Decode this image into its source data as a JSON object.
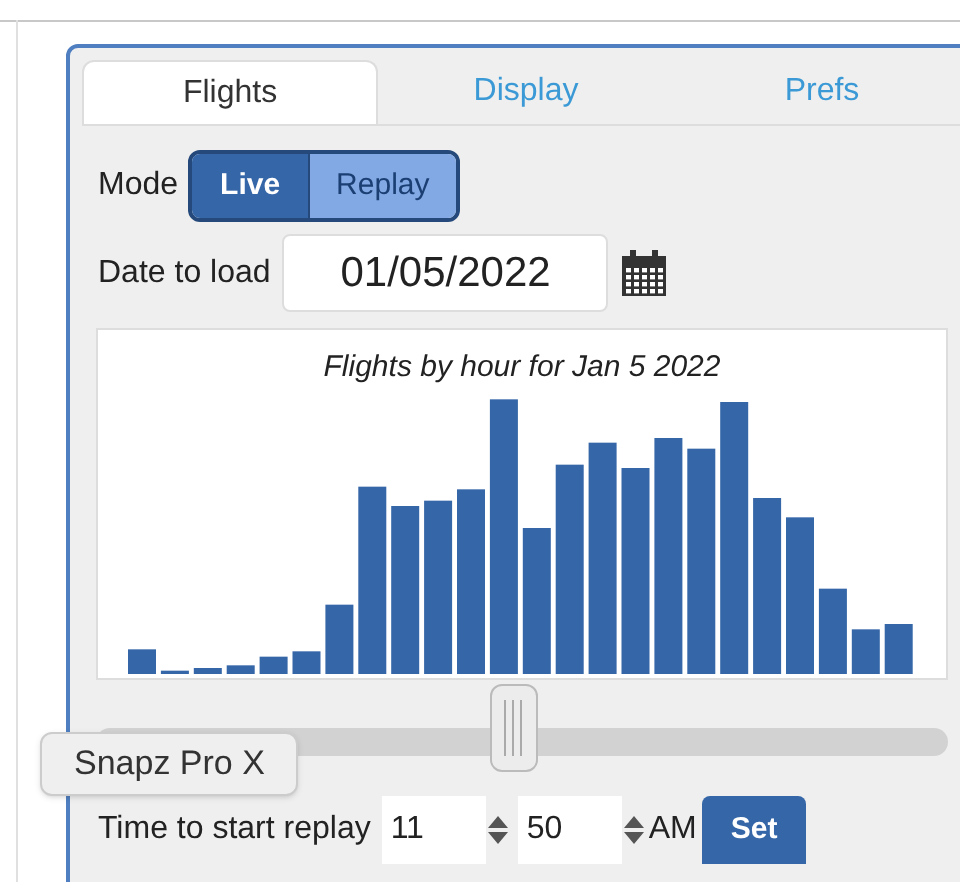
{
  "tabs": [
    {
      "label": "Flights",
      "selected": true
    },
    {
      "label": "Display",
      "selected": false
    },
    {
      "label": "Prefs",
      "selected": false
    }
  ],
  "mode": {
    "label": "Mode",
    "options": [
      {
        "label": "Live",
        "selected": true
      },
      {
        "label": "Replay",
        "selected": false
      }
    ]
  },
  "date": {
    "label": "Date to load",
    "value": "01/05/2022"
  },
  "chart": {
    "title": "Flights by hour for Jan 5 2022"
  },
  "slider": {
    "level": 0.49
  },
  "replay_time": {
    "label": "Time to start replay",
    "hour": "11",
    "minute": "50",
    "period": "AM",
    "button": "Set"
  },
  "tooltip": {
    "text": "Snapz Pro X"
  }
}
